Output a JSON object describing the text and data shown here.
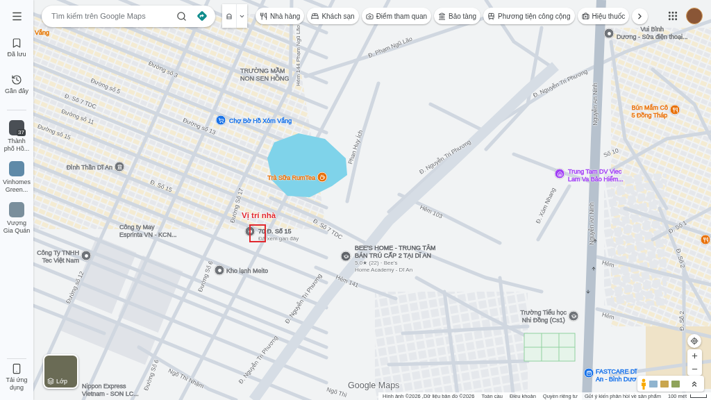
{
  "sidebar": {
    "items": [
      {
        "kind": "saved",
        "label": "Đã lưu"
      },
      {
        "kind": "recent",
        "label": "Gần đây"
      }
    ],
    "recent_places": [
      {
        "lines": [
          "Thành",
          "phố Hồ..."
        ],
        "badge": "37"
      },
      {
        "lines": [
          "Vinhomes",
          "Green..."
        ]
      },
      {
        "lines": [
          "Vượng",
          "Gia Quán"
        ]
      }
    ],
    "app_link": {
      "lines": [
        "Tải ứng",
        "dụng"
      ]
    }
  },
  "search": {
    "placeholder": "Tìm kiếm trên Google Maps"
  },
  "categories": [
    {
      "kind": "restaurant",
      "label": "Nhà hàng"
    },
    {
      "kind": "hotel",
      "label": "Khách sạn"
    },
    {
      "kind": "attraction",
      "label": "Điểm tham quan"
    },
    {
      "kind": "museum",
      "label": "Bảo tàng"
    },
    {
      "kind": "transit",
      "label": "Phương tiện công cộng"
    },
    {
      "kind": "pharmacy",
      "label": "Hiệu thuốc"
    }
  ],
  "map": {
    "streets": [
      "Hẻm 144 Phạm Ngũ Lão",
      "Đ. Phạm Ngũ Lão",
      "Đường số 3",
      "Đường số 5",
      "Đ. Số 7 TDC",
      "Đường số 11",
      "Đường số 13",
      "Đường số 15",
      "Đ. Số 15",
      "Phan Huy Ích",
      "Đ. Nguyễn Tri Phương",
      "Đ. Nguyễn Tri Phương",
      "Đ. Số 7 TDC",
      "Hẻm 103",
      "Đường Số 17",
      "Hẻm 141",
      "Đường số 12",
      "Đường Số 6",
      "Đ. Nguyễn Tri Phương",
      "Đ. Nguyễn Tri Phương",
      "Đường Số 6",
      "Ngõ Thì Nhậm",
      "Ngõ Thì",
      "Nguyễn An Ninh",
      "Số 10",
      "Nguyễn An Ninh",
      "Đ. Xóm Nhang",
      "Đ. Số 1",
      "Đ. Số 2",
      "Hẻm",
      "Hẻm",
      "Đ. Số 2"
    ],
    "places": [
      {
        "kind": "text",
        "color": "#e37400",
        "lines": [
          "Vắng"
        ]
      },
      {
        "kind": "pin",
        "color": "#6f7378",
        "lines": [
          "Vui Bình",
          "Dương - Sửa điện thoại..."
        ]
      },
      {
        "kind": "text",
        "color": "#6f7378",
        "lines": [
          "TRƯỜNG MẦM",
          "NON SEN HỒNG"
        ]
      },
      {
        "kind": "shop",
        "color": "#1a73e8",
        "lines": [
          "Chợ Bờ Hồ Xóm Vắng"
        ]
      },
      {
        "kind": "temple",
        "color": "#6f7378",
        "lines": [
          "Đình Thần Dĩ An"
        ]
      },
      {
        "kind": "cafe",
        "color": "#e8710a",
        "lines": [
          "Trà Sữa RumTea"
        ]
      },
      {
        "kind": "text",
        "color": "#6f7378",
        "lines": [
          "Công ty May",
          "Esprinta VN - KCN..."
        ]
      },
      {
        "kind": "pin",
        "color": "#6f7378",
        "lines": [
          "Công Ty TNHH",
          "Tec Việt Nam"
        ]
      },
      {
        "kind": "pin",
        "color": "#6f7378",
        "lines": [
          "Kho lạnh Meito"
        ]
      },
      {
        "kind": "school",
        "color": "#5f6368",
        "lines": [
          "BEE'S HOME - TRUNG TÂM",
          "BÁN TRÚ CẤP 2 TẠI DĨ AN"
        ],
        "details": [
          "5.0★ (22) · Bee's",
          "Home Academy - Dĩ An"
        ]
      },
      {
        "kind": "text",
        "color": "#6f7378",
        "lines": [
          "Nippon Express",
          "Vietnam - SON LC..."
        ]
      },
      {
        "kind": "food",
        "color": "#e8710a",
        "lines": [
          "Bún Mắm Cô",
          "5 Đồng Tháp"
        ]
      },
      {
        "kind": "office",
        "color": "#a142f4",
        "lines": [
          "Trung Tam DV Viec",
          "Lam Va Bảo Hiểm..."
        ]
      },
      {
        "kind": "school",
        "color": "#6f7378",
        "lines": [
          "Trường Tiểu học",
          "Nhi Đồng (Cs1)"
        ]
      },
      {
        "kind": "health",
        "color": "#1a73e8",
        "lines": [
          "FASTCARE Dĩ",
          "An - Bình Dươ"
        ]
      },
      {
        "kind": "food",
        "color": "#e8710a"
      }
    ],
    "pinned": {
      "annotation": "Vị trí nhà",
      "title": "70 Đ. Số 15",
      "subtitle": "Đã xem gần đây"
    }
  },
  "layers_button": {
    "label": "Lớp"
  },
  "logo": "Google Maps",
  "footer": {
    "attribution": "Hình ảnh ©2026 ,Dữ liệu bản đồ ©2026",
    "links": [
      "Toàn cầu",
      "Điều khoản",
      "Quyền riêng tư",
      "Gửi ý kiến phản hồi về sản phẩm"
    ],
    "scale": "100 mét"
  }
}
